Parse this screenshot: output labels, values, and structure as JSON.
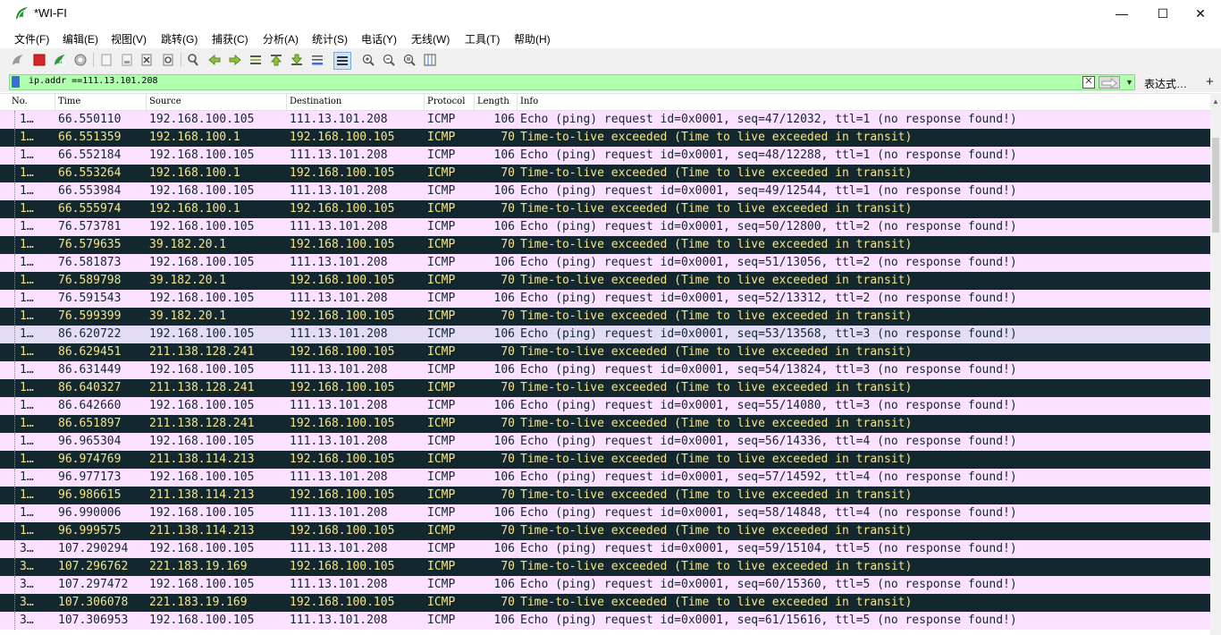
{
  "window": {
    "title": "*WI-FI",
    "minimize_glyph": "—",
    "maximize_glyph": "☐",
    "close_glyph": "✕"
  },
  "menu": [
    "文件(F)",
    "编辑(E)",
    "视图(V)",
    "跳转(G)",
    "捕获(C)",
    "分析(A)",
    "统计(S)",
    "电话(Y)",
    "无线(W)",
    "工具(T)",
    "帮助(H)"
  ],
  "toolbar_icons": [
    "start-capture-icon",
    "stop-capture-icon",
    "restart-capture-icon",
    "capture-options-icon",
    "open-file-icon",
    "save-file-icon",
    "close-file-icon",
    "reload-file-icon",
    "find-packet-icon",
    "go-back-icon",
    "go-forward-icon",
    "go-to-packet-icon",
    "go-first-icon",
    "go-last-icon",
    "auto-scroll-icon",
    "colorize-icon",
    "zoom-in-icon",
    "zoom-out-icon",
    "zoom-normal-icon",
    "resize-columns-icon"
  ],
  "filter": {
    "value": "ip.addr ==111.13.101.208",
    "clear_glyph": "✕",
    "dropdown_glyph": "▼",
    "expression_label": "表达式…",
    "add_label": "+"
  },
  "columns": [
    "No.",
    "Time",
    "Source",
    "Destination",
    "Protocol",
    "Length",
    "Info"
  ],
  "colors": {
    "request_bg": "#fce0ff",
    "ttl_bg": "#12272e",
    "ttl_fg": "#f7e58d",
    "selected_bg": "#e2dcf7",
    "filter_bg": "#afffaf"
  },
  "rows": [
    {
      "no": "1…",
      "time": "66.550110",
      "src": "192.168.100.105",
      "dst": "111.13.101.208",
      "proto": "ICMP",
      "len": "106",
      "info": "Echo (ping) request  id=0x0001, seq=47/12032, ttl=1 (no response found!)",
      "kind": "req"
    },
    {
      "no": "1…",
      "time": "66.551359",
      "src": "192.168.100.1",
      "dst": "192.168.100.105",
      "proto": "ICMP",
      "len": "70",
      "info": "Time-to-live exceeded (Time to live exceeded in transit)",
      "kind": "ttl"
    },
    {
      "no": "1…",
      "time": "66.552184",
      "src": "192.168.100.105",
      "dst": "111.13.101.208",
      "proto": "ICMP",
      "len": "106",
      "info": "Echo (ping) request  id=0x0001, seq=48/12288, ttl=1 (no response found!)",
      "kind": "req"
    },
    {
      "no": "1…",
      "time": "66.553264",
      "src": "192.168.100.1",
      "dst": "192.168.100.105",
      "proto": "ICMP",
      "len": "70",
      "info": "Time-to-live exceeded (Time to live exceeded in transit)",
      "kind": "ttl"
    },
    {
      "no": "1…",
      "time": "66.553984",
      "src": "192.168.100.105",
      "dst": "111.13.101.208",
      "proto": "ICMP",
      "len": "106",
      "info": "Echo (ping) request  id=0x0001, seq=49/12544, ttl=1 (no response found!)",
      "kind": "req"
    },
    {
      "no": "1…",
      "time": "66.555974",
      "src": "192.168.100.1",
      "dst": "192.168.100.105",
      "proto": "ICMP",
      "len": "70",
      "info": "Time-to-live exceeded (Time to live exceeded in transit)",
      "kind": "ttl"
    },
    {
      "no": "1…",
      "time": "76.573781",
      "src": "192.168.100.105",
      "dst": "111.13.101.208",
      "proto": "ICMP",
      "len": "106",
      "info": "Echo (ping) request  id=0x0001, seq=50/12800, ttl=2 (no response found!)",
      "kind": "req"
    },
    {
      "no": "1…",
      "time": "76.579635",
      "src": "39.182.20.1",
      "dst": "192.168.100.105",
      "proto": "ICMP",
      "len": "70",
      "info": "Time-to-live exceeded (Time to live exceeded in transit)",
      "kind": "ttl"
    },
    {
      "no": "1…",
      "time": "76.581873",
      "src": "192.168.100.105",
      "dst": "111.13.101.208",
      "proto": "ICMP",
      "len": "106",
      "info": "Echo (ping) request  id=0x0001, seq=51/13056, ttl=2 (no response found!)",
      "kind": "req"
    },
    {
      "no": "1…",
      "time": "76.589798",
      "src": "39.182.20.1",
      "dst": "192.168.100.105",
      "proto": "ICMP",
      "len": "70",
      "info": "Time-to-live exceeded (Time to live exceeded in transit)",
      "kind": "ttl"
    },
    {
      "no": "1…",
      "time": "76.591543",
      "src": "192.168.100.105",
      "dst": "111.13.101.208",
      "proto": "ICMP",
      "len": "106",
      "info": "Echo (ping) request  id=0x0001, seq=52/13312, ttl=2 (no response found!)",
      "kind": "req"
    },
    {
      "no": "1…",
      "time": "76.599399",
      "src": "39.182.20.1",
      "dst": "192.168.100.105",
      "proto": "ICMP",
      "len": "70",
      "info": "Time-to-live exceeded (Time to live exceeded in transit)",
      "kind": "ttl"
    },
    {
      "no": "1…",
      "time": "86.620722",
      "src": "192.168.100.105",
      "dst": "111.13.101.208",
      "proto": "ICMP",
      "len": "106",
      "info": "Echo (ping) request  id=0x0001, seq=53/13568, ttl=3 (no response found!)",
      "kind": "sel"
    },
    {
      "no": "1…",
      "time": "86.629451",
      "src": "211.138.128.241",
      "dst": "192.168.100.105",
      "proto": "ICMP",
      "len": "70",
      "info": "Time-to-live exceeded (Time to live exceeded in transit)",
      "kind": "ttl"
    },
    {
      "no": "1…",
      "time": "86.631449",
      "src": "192.168.100.105",
      "dst": "111.13.101.208",
      "proto": "ICMP",
      "len": "106",
      "info": "Echo (ping) request  id=0x0001, seq=54/13824, ttl=3 (no response found!)",
      "kind": "req"
    },
    {
      "no": "1…",
      "time": "86.640327",
      "src": "211.138.128.241",
      "dst": "192.168.100.105",
      "proto": "ICMP",
      "len": "70",
      "info": "Time-to-live exceeded (Time to live exceeded in transit)",
      "kind": "ttl"
    },
    {
      "no": "1…",
      "time": "86.642660",
      "src": "192.168.100.105",
      "dst": "111.13.101.208",
      "proto": "ICMP",
      "len": "106",
      "info": "Echo (ping) request  id=0x0001, seq=55/14080, ttl=3 (no response found!)",
      "kind": "req"
    },
    {
      "no": "1…",
      "time": "86.651897",
      "src": "211.138.128.241",
      "dst": "192.168.100.105",
      "proto": "ICMP",
      "len": "70",
      "info": "Time-to-live exceeded (Time to live exceeded in transit)",
      "kind": "ttl"
    },
    {
      "no": "1…",
      "time": "96.965304",
      "src": "192.168.100.105",
      "dst": "111.13.101.208",
      "proto": "ICMP",
      "len": "106",
      "info": "Echo (ping) request  id=0x0001, seq=56/14336, ttl=4 (no response found!)",
      "kind": "req"
    },
    {
      "no": "1…",
      "time": "96.974769",
      "src": "211.138.114.213",
      "dst": "192.168.100.105",
      "proto": "ICMP",
      "len": "70",
      "info": "Time-to-live exceeded (Time to live exceeded in transit)",
      "kind": "ttl"
    },
    {
      "no": "1…",
      "time": "96.977173",
      "src": "192.168.100.105",
      "dst": "111.13.101.208",
      "proto": "ICMP",
      "len": "106",
      "info": "Echo (ping) request  id=0x0001, seq=57/14592, ttl=4 (no response found!)",
      "kind": "req"
    },
    {
      "no": "1…",
      "time": "96.986615",
      "src": "211.138.114.213",
      "dst": "192.168.100.105",
      "proto": "ICMP",
      "len": "70",
      "info": "Time-to-live exceeded (Time to live exceeded in transit)",
      "kind": "ttl"
    },
    {
      "no": "1…",
      "time": "96.990006",
      "src": "192.168.100.105",
      "dst": "111.13.101.208",
      "proto": "ICMP",
      "len": "106",
      "info": "Echo (ping) request  id=0x0001, seq=58/14848, ttl=4 (no response found!)",
      "kind": "req"
    },
    {
      "no": "1…",
      "time": "96.999575",
      "src": "211.138.114.213",
      "dst": "192.168.100.105",
      "proto": "ICMP",
      "len": "70",
      "info": "Time-to-live exceeded (Time to live exceeded in transit)",
      "kind": "ttl"
    },
    {
      "no": "3…",
      "time": "107.290294",
      "src": "192.168.100.105",
      "dst": "111.13.101.208",
      "proto": "ICMP",
      "len": "106",
      "info": "Echo (ping) request  id=0x0001, seq=59/15104, ttl=5 (no response found!)",
      "kind": "req"
    },
    {
      "no": "3…",
      "time": "107.296762",
      "src": "221.183.19.169",
      "dst": "192.168.100.105",
      "proto": "ICMP",
      "len": "70",
      "info": "Time-to-live exceeded (Time to live exceeded in transit)",
      "kind": "ttl"
    },
    {
      "no": "3…",
      "time": "107.297472",
      "src": "192.168.100.105",
      "dst": "111.13.101.208",
      "proto": "ICMP",
      "len": "106",
      "info": "Echo (ping) request  id=0x0001, seq=60/15360, ttl=5 (no response found!)",
      "kind": "req"
    },
    {
      "no": "3…",
      "time": "107.306078",
      "src": "221.183.19.169",
      "dst": "192.168.100.105",
      "proto": "ICMP",
      "len": "70",
      "info": "Time-to-live exceeded (Time to live exceeded in transit)",
      "kind": "ttl"
    },
    {
      "no": "3…",
      "time": "107.306953",
      "src": "192.168.100.105",
      "dst": "111.13.101.208",
      "proto": "ICMP",
      "len": "106",
      "info": "Echo (ping) request  id=0x0001, seq=61/15616, ttl=5 (no response found!)",
      "kind": "req"
    }
  ]
}
